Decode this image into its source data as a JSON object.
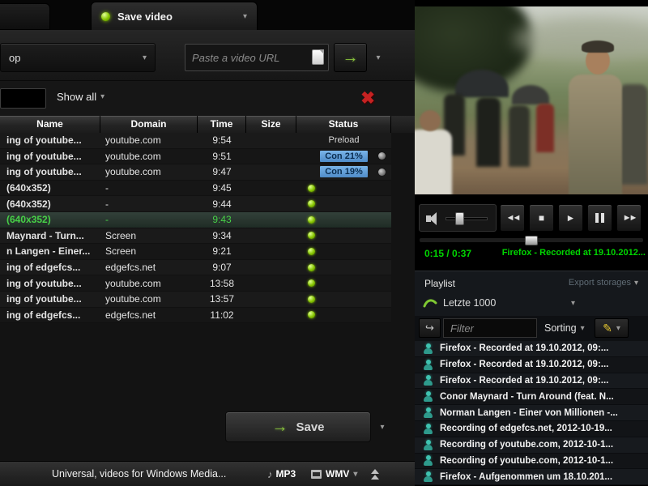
{
  "icons": {
    "chevron_down": "▾",
    "close": "✖",
    "go_arrow": "→",
    "save_arrow": "→",
    "rewind": "◄◄",
    "stop": "■",
    "play": "►",
    "forward": "►►",
    "music_note": "♪",
    "edit": "✎",
    "filter_jump": "↪"
  },
  "tabs": {
    "active_tab": "Save video"
  },
  "toolbar": {
    "source_dropdown": "op",
    "url_placeholder": "Paste a video URL",
    "show_all": "Show all"
  },
  "table": {
    "columns": [
      "Name",
      "Domain",
      "Time",
      "Size",
      "Status"
    ],
    "rows": [
      {
        "name": "ing of  youtube...",
        "domain": "youtube.com",
        "time": "9:54",
        "size": "",
        "status": "Preload",
        "type": "preload",
        "selected": false
      },
      {
        "name": "ing of  youtube...",
        "domain": "youtube.com",
        "time": "9:51",
        "size": "",
        "status": "Con 21%",
        "type": "progress",
        "selected": false
      },
      {
        "name": "ing of  youtube...",
        "domain": "youtube.com",
        "time": "9:47",
        "size": "",
        "status": "Con 19%",
        "type": "progress",
        "selected": false
      },
      {
        "name": "(640x352)",
        "domain": "-",
        "time": "9:45",
        "size": "",
        "status": "",
        "type": "dot",
        "selected": false
      },
      {
        "name": "(640x352)",
        "domain": "-",
        "time": "9:44",
        "size": "",
        "status": "",
        "type": "dot",
        "selected": false
      },
      {
        "name": "(640x352)",
        "domain": "-",
        "time": "9:43",
        "size": "",
        "status": "",
        "type": "dot",
        "selected": true
      },
      {
        "name": "Maynard - Turn...",
        "domain": "Screen",
        "time": "9:34",
        "size": "",
        "status": "",
        "type": "dot",
        "selected": false
      },
      {
        "name": "n Langen - Einer...",
        "domain": "Screen",
        "time": "9:21",
        "size": "",
        "status": "",
        "type": "dot",
        "selected": false
      },
      {
        "name": "ing of  edgefcs...",
        "domain": "edgefcs.net",
        "time": "9:07",
        "size": "",
        "status": "",
        "type": "dot",
        "selected": false
      },
      {
        "name": "ing of  youtube...",
        "domain": "youtube.com",
        "time": "13:58",
        "size": "",
        "status": "",
        "type": "dot",
        "selected": false
      },
      {
        "name": "ing of  youtube...",
        "domain": "youtube.com",
        "time": "13:57",
        "size": "",
        "status": "",
        "type": "dot",
        "selected": false
      },
      {
        "name": "ing of  edgefcs...",
        "domain": "edgefcs.net",
        "time": "11:02",
        "size": "",
        "status": "",
        "type": "dot",
        "selected": false
      }
    ]
  },
  "save": {
    "label": "Save"
  },
  "bottom": {
    "profile": "Universal, videos for Windows Media...",
    "audio_format": "MP3",
    "video_format": "WMV"
  },
  "player": {
    "time": "0:15 / 0:37",
    "now_playing": "Firefox - Recorded at 19.10.2012...",
    "progress_percent": 50
  },
  "playlist": {
    "label": "Playlist",
    "export_label": "Export storages",
    "selected_playlist": "Letzte 1000",
    "filter_placeholder": "Filter",
    "sorting_label": "Sorting",
    "items": [
      "Firefox - Recorded at 19.10.2012, 09:...",
      "Firefox - Recorded at 19.10.2012, 09:...",
      "Firefox - Recorded at 19.10.2012, 09:...",
      "Conor Maynard - Turn Around (feat. N...",
      "Norman Langen - Einer von Millionen -...",
      "Recording of  edgefcs.net, 2012-10-19...",
      "Recording of  youtube.com, 2012-10-1...",
      "Recording of  youtube.com, 2012-10-1...",
      "Firefox - Aufgenommen um 18.10.201..."
    ]
  }
}
